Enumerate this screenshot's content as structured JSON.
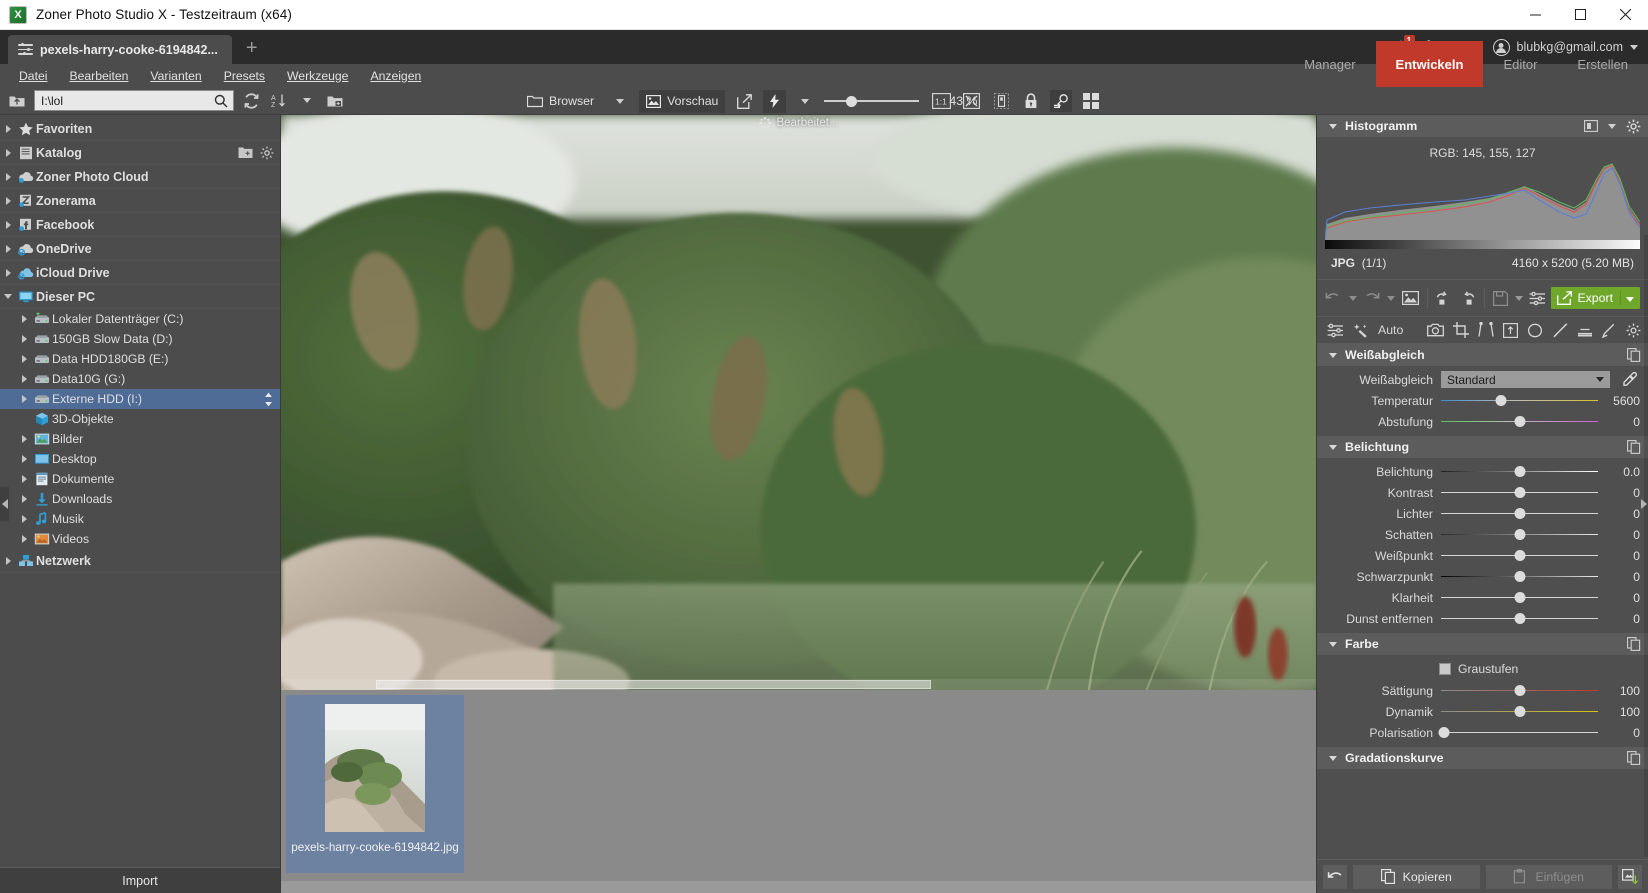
{
  "window": {
    "title": "Zoner Photo Studio X - Testzeitraum (x64)",
    "minimize": "─",
    "maximize": "☐",
    "close": "✕"
  },
  "header": {
    "tab_label": "pexels-harry-cooke-6194842...",
    "new_tab": "+",
    "notification_badge": "1",
    "account_email": "blubkg@gmail.com"
  },
  "menubar": {
    "items": [
      "Datei",
      "Bearbeiten",
      "Varianten",
      "Presets",
      "Werkzeuge",
      "Anzeigen"
    ]
  },
  "mode_tabs": [
    {
      "label": "Manager",
      "active": false
    },
    {
      "label": "Entwickeln",
      "active": true
    },
    {
      "label": "Editor",
      "active": false
    },
    {
      "label": "Erstellen",
      "active": false
    }
  ],
  "toolbar": {
    "address_value": "I:\\lol",
    "address_placeholder": "",
    "browser_label": "Browser",
    "preview_label": "Vorschau",
    "zoom_percent": "43 %"
  },
  "sidebar": {
    "import_label": "Import",
    "nodes": [
      {
        "label": "Favoriten",
        "level": 0,
        "root": true,
        "expanded": false,
        "icon": "star-icon"
      },
      {
        "label": "Katalog",
        "level": 0,
        "root": true,
        "expanded": false,
        "icon": "catalog-icon"
      },
      {
        "label": "Zoner Photo Cloud",
        "level": 0,
        "root": true,
        "expanded": false,
        "icon": "cloud-icon"
      },
      {
        "label": "Zonerama",
        "level": 0,
        "root": true,
        "expanded": false,
        "icon": "zonerama-icon"
      },
      {
        "label": "Facebook",
        "level": 0,
        "root": true,
        "expanded": false,
        "icon": "facebook-icon"
      },
      {
        "label": "OneDrive",
        "level": 0,
        "root": true,
        "expanded": false,
        "icon": "onedrive-icon"
      },
      {
        "label": "iCloud Drive",
        "level": 0,
        "root": true,
        "expanded": false,
        "icon": "icloud-icon"
      },
      {
        "label": "Dieser PC",
        "level": 0,
        "root": true,
        "expanded": true,
        "icon": "monitor-icon"
      },
      {
        "label": "Lokaler Datenträger (C:)",
        "level": 1,
        "root": false,
        "expanded": false,
        "icon": "drive-system-icon"
      },
      {
        "label": "150GB Slow Data (D:)",
        "level": 1,
        "root": false,
        "expanded": false,
        "icon": "drive-icon"
      },
      {
        "label": "Data HDD180GB (E:)",
        "level": 1,
        "root": false,
        "expanded": false,
        "icon": "drive-icon"
      },
      {
        "label": "Data10G (G:)",
        "level": 1,
        "root": false,
        "expanded": false,
        "icon": "drive-icon"
      },
      {
        "label": "Externe HDD (I:)",
        "level": 1,
        "root": false,
        "expanded": false,
        "icon": "drive-icon",
        "selected": true
      },
      {
        "label": "3D-Objekte",
        "level": 1,
        "root": false,
        "expanded": null,
        "icon": "3d-objects-icon"
      },
      {
        "label": "Bilder",
        "level": 1,
        "root": false,
        "expanded": false,
        "icon": "pictures-icon"
      },
      {
        "label": "Desktop",
        "level": 1,
        "root": false,
        "expanded": false,
        "icon": "desktop-icon"
      },
      {
        "label": "Dokumente",
        "level": 1,
        "root": false,
        "expanded": false,
        "icon": "documents-icon"
      },
      {
        "label": "Downloads",
        "level": 1,
        "root": false,
        "expanded": false,
        "icon": "downloads-icon"
      },
      {
        "label": "Musik",
        "level": 1,
        "root": false,
        "expanded": false,
        "icon": "music-icon"
      },
      {
        "label": "Videos",
        "level": 1,
        "root": false,
        "expanded": false,
        "icon": "videos-icon"
      },
      {
        "label": "Netzwerk",
        "level": 0,
        "root": true,
        "expanded": false,
        "icon": "network-icon"
      }
    ]
  },
  "canvas": {
    "edited_label": "Bearbeitet..."
  },
  "filmstrip": {
    "items": [
      {
        "name": "pexels-harry-cooke-6194842.jpg",
        "selected": true
      }
    ]
  },
  "right_panel": {
    "histogram": {
      "title": "Histogramm",
      "rgb_readout": "RGB: 145, 155, 127",
      "format": "JPG",
      "counter": "(1/1)",
      "dimensions": "4160 x 5200 (5.20 MB)"
    },
    "export_label": "Export",
    "auto_label": "Auto",
    "sections": [
      {
        "title": "Weißabgleich",
        "rows": [
          {
            "label": "Weißabgleich",
            "type": "select",
            "value": "Standard"
          },
          {
            "label": "Temperatur",
            "type": "slider",
            "value": "5600",
            "pos": 38,
            "track": "temperature"
          },
          {
            "label": "Abstufung",
            "type": "slider",
            "value": "0",
            "pos": 50,
            "track": "tint"
          }
        ]
      },
      {
        "title": "Belichtung",
        "rows": [
          {
            "label": "Belichtung",
            "type": "slider",
            "value": "0.0",
            "pos": 50,
            "track": "exposure"
          },
          {
            "label": "Kontrast",
            "type": "slider",
            "value": "0",
            "pos": 50,
            "track": "plain"
          },
          {
            "label": "Lichter",
            "type": "slider",
            "value": "0",
            "pos": 50,
            "track": "plain"
          },
          {
            "label": "Schatten",
            "type": "slider",
            "value": "0",
            "pos": 50,
            "track": "shadows"
          },
          {
            "label": "Weißpunkt",
            "type": "slider",
            "value": "0",
            "pos": 50,
            "track": "plain"
          },
          {
            "label": "Schwarzpunkt",
            "type": "slider",
            "value": "0",
            "pos": 50,
            "track": "blacks"
          },
          {
            "label": "Klarheit",
            "type": "slider",
            "value": "0",
            "pos": 50,
            "track": "plain"
          },
          {
            "label": "Dunst entfernen",
            "type": "slider",
            "value": "0",
            "pos": 50,
            "track": "plain"
          }
        ]
      },
      {
        "title": "Farbe",
        "rows": [
          {
            "label": "Graustufen",
            "type": "checkbox",
            "checked": false
          },
          {
            "label": "Sättigung",
            "type": "slider",
            "value": "100",
            "pos": 50,
            "track": "saturation"
          },
          {
            "label": "Dynamik",
            "type": "slider",
            "value": "100",
            "pos": 50,
            "track": "vibrance"
          },
          {
            "label": "Polarisation",
            "type": "slider",
            "value": "0",
            "pos": 2,
            "track": "plain"
          }
        ]
      },
      {
        "title": "Gradationskurve",
        "rows": []
      }
    ],
    "bottom": {
      "copy_label": "Kopieren",
      "paste_label": "Einfügen"
    }
  }
}
